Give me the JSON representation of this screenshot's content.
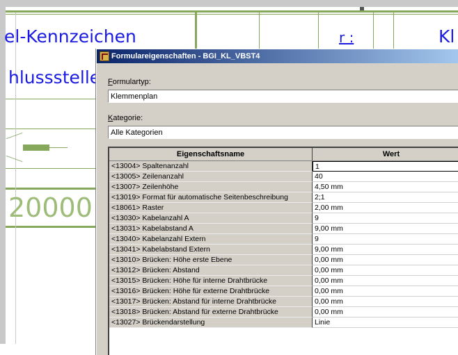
{
  "background": {
    "text_1": "el-Kennzeichen",
    "text_2": "hlussstelle",
    "text_3": "Kl",
    "text_4": "r :",
    "text_5": "20000"
  },
  "dialog": {
    "title": "Formulareigenschaften - BGI_KL_VBST4",
    "formulartyp_label_underlined": "F",
    "formulartyp_label_rest": "ormulartyp:",
    "formulartyp_value": "Klemmenplan",
    "kategorie_label_underlined": "K",
    "kategorie_label_rest": "ategorie:",
    "kategorie_value": "Alle Kategorien"
  },
  "table": {
    "columns": [
      "Eigenschaftsname",
      "Wert"
    ],
    "rows": [
      {
        "name": "<13004> Spaltenanzahl",
        "value": "1"
      },
      {
        "name": "<13005> Zeilenanzahl",
        "value": "40"
      },
      {
        "name": "<13007> Zeilenhöhe",
        "value": "4,50 mm"
      },
      {
        "name": "<13019> Format für automatische Seitenbeschreibung",
        "value": "2;1"
      },
      {
        "name": "<18061> Raster",
        "value": "2,00 mm"
      },
      {
        "name": "<13030> Kabelanzahl A",
        "value": "9"
      },
      {
        "name": "<13031> Kabelabstand A",
        "value": "9,00 mm"
      },
      {
        "name": "<13040> Kabelanzahl Extern",
        "value": "9"
      },
      {
        "name": "<13041> Kabelabstand Extern",
        "value": "9,00 mm"
      },
      {
        "name": "<13010> Brücken: Höhe erste Ebene",
        "value": "0,00 mm"
      },
      {
        "name": "<13012> Brücken: Abstand",
        "value": "0,00 mm"
      },
      {
        "name": "<13015> Brücken: Höhe für interne Drahtbrücke",
        "value": "0,00 mm"
      },
      {
        "name": "<13016> Brücken: Höhe für externe Drahtbrücke",
        "value": "0,00 mm"
      },
      {
        "name": "<13017> Brücken: Abstand für interne Drahtbrücke",
        "value": "0,00 mm"
      },
      {
        "name": "<13018> Brücken: Abstand für externe Drahtbrücke",
        "value": "0,00 mm"
      },
      {
        "name": "<13027> Brückendarstellung",
        "value": "Linie"
      }
    ]
  },
  "colors": {
    "titlebar_start": "#0a246a",
    "titlebar_end": "#a6caf0",
    "drawing_line": "#86a85a",
    "drawing_text": "#1a1ae0",
    "dialog_face": "#d4d0c8"
  }
}
